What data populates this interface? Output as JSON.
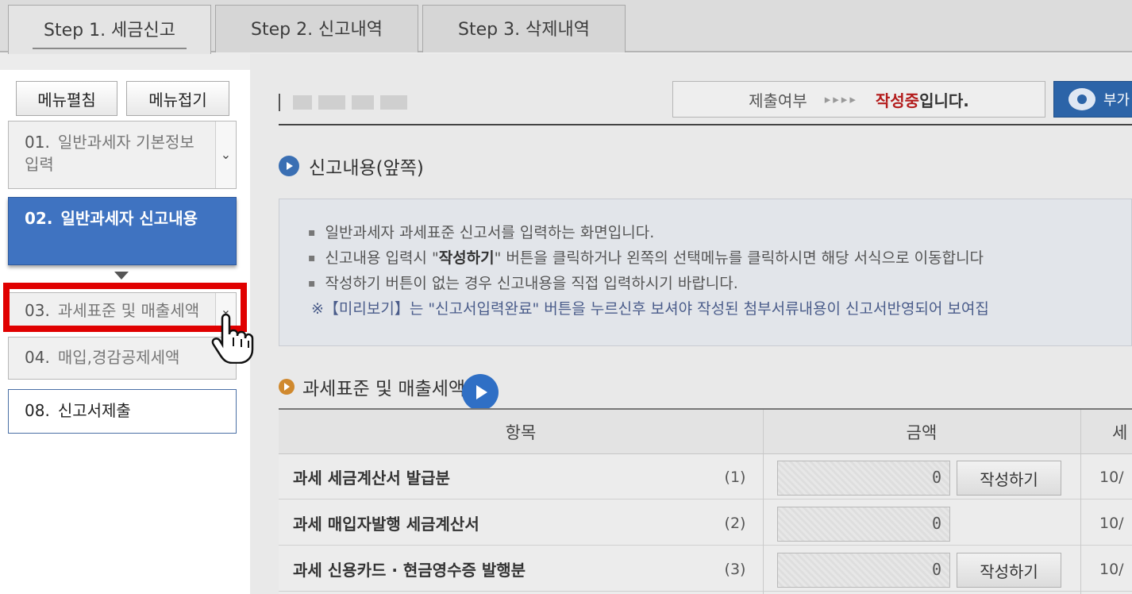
{
  "tabs": [
    {
      "label": "Step 1. 세금신고",
      "active": true
    },
    {
      "label": "Step 2. 신고내역",
      "active": false
    },
    {
      "label": "Step 3. 삭제내역",
      "active": false
    }
  ],
  "sidebar": {
    "expand_label": "메뉴펼침",
    "collapse_label": "메뉴접기",
    "steps": [
      {
        "num": "01.",
        "label": "일반과세자 기본정보 입력"
      },
      {
        "num": "02.",
        "label": "일반과세자 신고내용"
      },
      {
        "num": "03.",
        "label": "과세표준 및 매출세액"
      },
      {
        "num": "04.",
        "label": "매입,경감공제세액"
      },
      {
        "num": "08.",
        "label": "신고서제출"
      }
    ],
    "chevron_glyph": "⌄"
  },
  "status": {
    "label": "제출여부",
    "arrows": "▸▸▸▸",
    "state": "작성중",
    "state_tail": "입니다.",
    "side_button_label": "부가",
    "state_color": "#b31b1b"
  },
  "section1": {
    "title": "신고내용(앞쪽)",
    "bullets": [
      "일반과세자 과세표준 신고서를 입력하는 화면입니다.",
      {
        "pre": "신고내용 입력시 \"",
        "bold": "작성하기",
        "post": "\" 버튼을 클릭하거나 왼쪽의 선택메뉴를 클릭하시면 해당 서식으로 이동합니다"
      },
      "작성하기 버튼이 없는 경우 신고내용을 직접 입력하시기 바랍니다."
    ],
    "note": "※【미리보기】는 \"신고서입력완료\" 버튼을 누르신후 보셔야 작성된 첨부서류내용이 신고서반영되어 보여집"
  },
  "section2": {
    "title": "과세표준 및 매출세액",
    "headers": {
      "item": "항목",
      "amount": "금액",
      "tax": "세"
    },
    "rows": [
      {
        "label": "과세 세금계산서 발급분",
        "code": "(1)",
        "amount": "0",
        "button": "작성하기",
        "tax": "10/"
      },
      {
        "label": "과세 매입자발행 세금계산서",
        "code": "(2)",
        "amount": "0",
        "button": "",
        "tax": "10/"
      },
      {
        "label": "과세 신용카드 · 현금영수증 발행분",
        "code": "(3)",
        "amount": "0",
        "button": "작성하기",
        "tax": "10/"
      }
    ]
  },
  "colors": {
    "active_step": "#3f73c1",
    "highlight": "#e00000",
    "play_button": "#2f6fc5"
  }
}
